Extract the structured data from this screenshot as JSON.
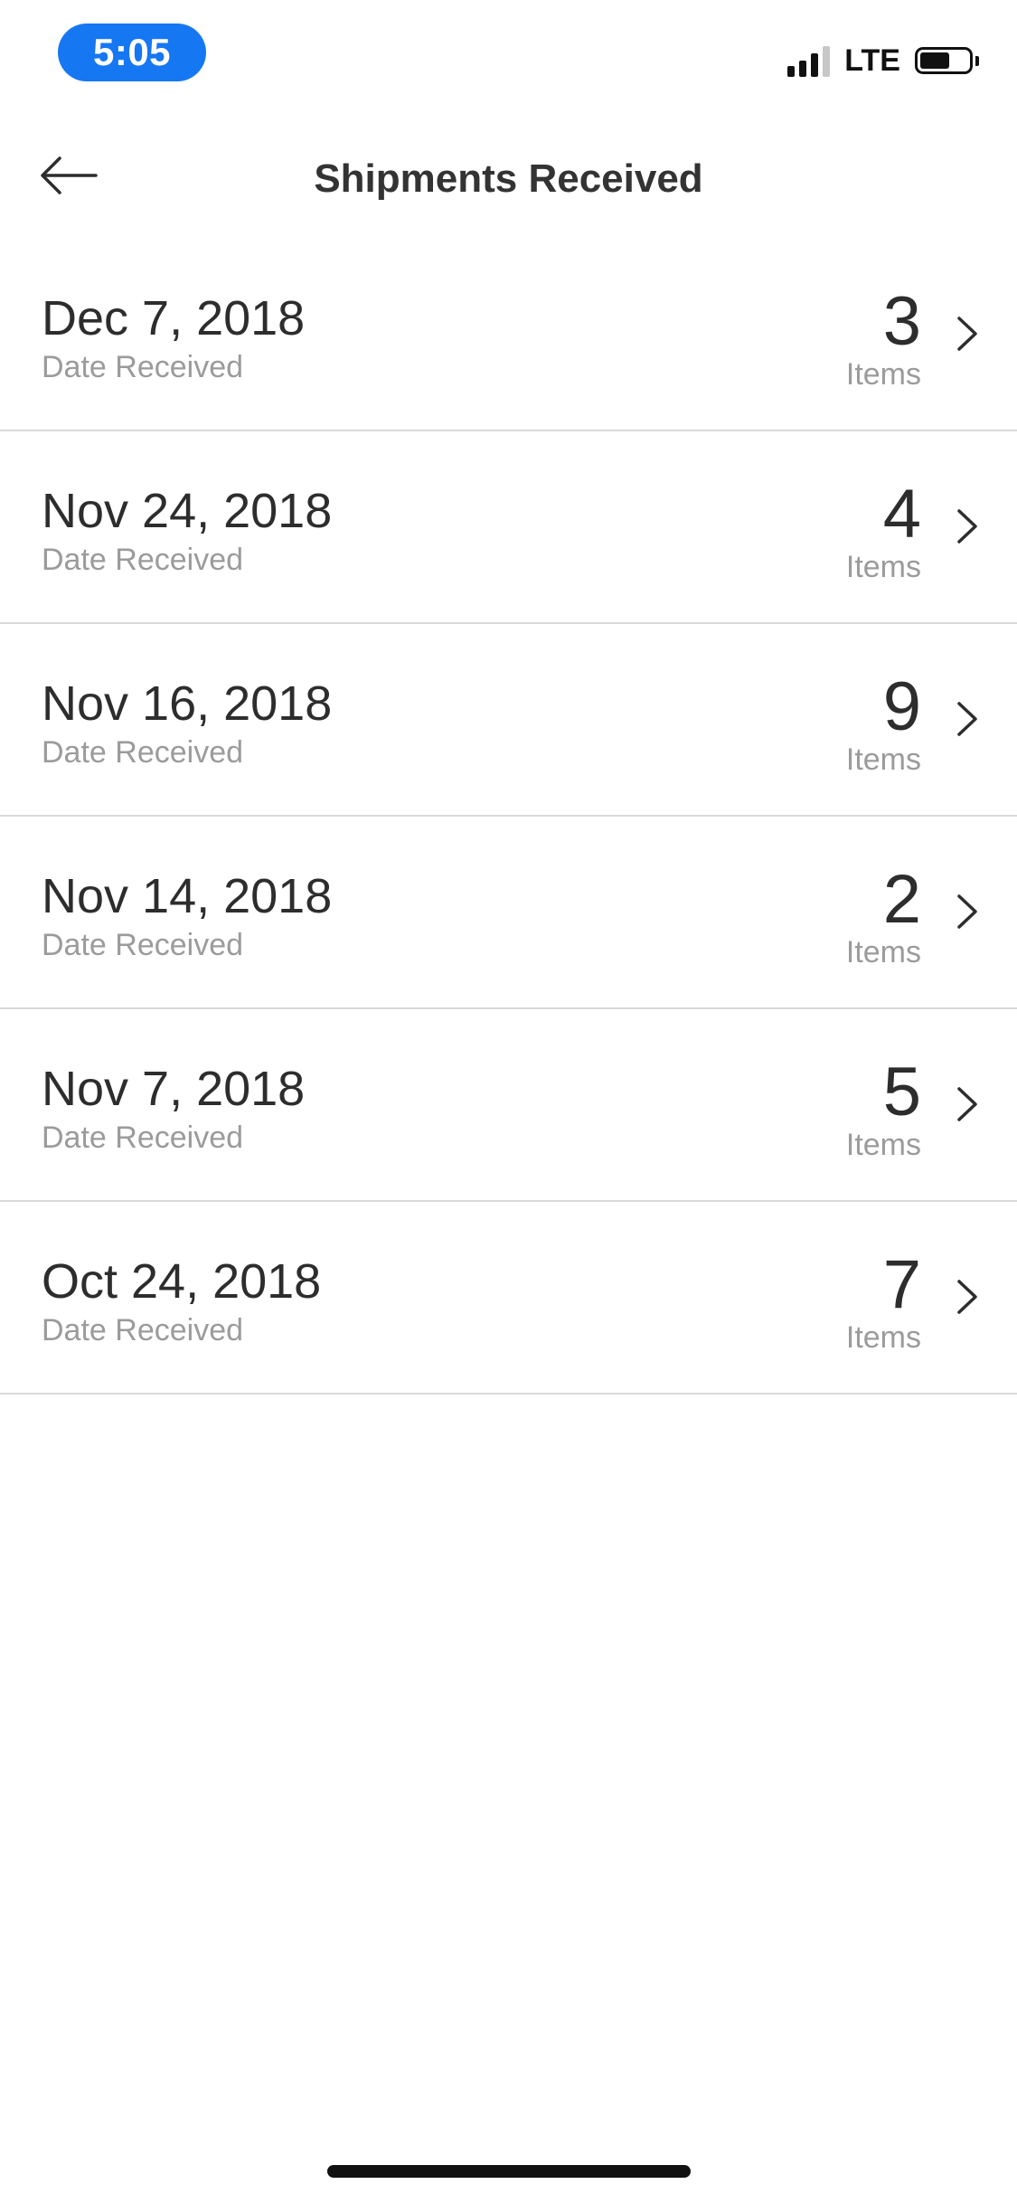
{
  "status_bar": {
    "time": "5:05",
    "network": "LTE",
    "icons": [
      "signal-icon",
      "battery-icon"
    ]
  },
  "nav": {
    "title": "Shipments Received",
    "back_icon": "back-arrow-icon"
  },
  "shipments": [
    {
      "date": "Dec 7, 2018",
      "date_label": "Date Received",
      "count": "3",
      "count_label": "Items"
    },
    {
      "date": "Nov 24, 2018",
      "date_label": "Date Received",
      "count": "4",
      "count_label": "Items"
    },
    {
      "date": "Nov 16, 2018",
      "date_label": "Date Received",
      "count": "9",
      "count_label": "Items"
    },
    {
      "date": "Nov 14, 2018",
      "date_label": "Date Received",
      "count": "2",
      "count_label": "Items"
    },
    {
      "date": "Nov 7, 2018",
      "date_label": "Date Received",
      "count": "5",
      "count_label": "Items"
    },
    {
      "date": "Oct 24, 2018",
      "date_label": "Date Received",
      "count": "7",
      "count_label": "Items"
    }
  ],
  "colors": {
    "accent": "#1677f2",
    "text_primary": "#2d2d2d",
    "text_secondary": "#9b9b9b",
    "divider": "#d9d9d9"
  }
}
